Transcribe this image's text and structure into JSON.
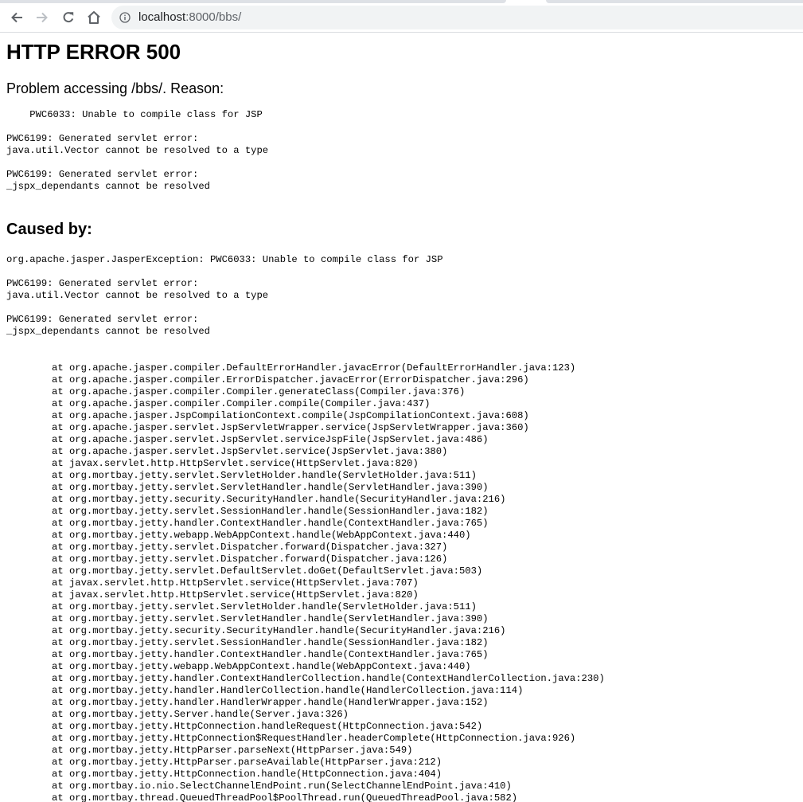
{
  "browser": {
    "url_host": "localhost",
    "url_rest": ":8000/bbs/",
    "icons": [
      "back-arrow-icon",
      "forward-arrow-icon",
      "reload-icon",
      "home-icon",
      "info-icon"
    ]
  },
  "page": {
    "title": "HTTP ERROR 500",
    "reason": "Problem accessing /bbs/. Reason:",
    "reason_message": "    PWC6033: Unable to compile class for JSP",
    "error1_line1": "PWC6199: Generated servlet error:",
    "error1_line2": "java.util.Vector cannot be resolved to a type",
    "error2_line1": "PWC6199: Generated servlet error:",
    "error2_line2": "_jspx_dependants cannot be resolved",
    "caused_by": "Caused by:",
    "exception": "org.apache.jasper.JasperException: PWC6033: Unable to compile class for JSP",
    "cause_error1_line1": "PWC6199: Generated servlet error:",
    "cause_error1_line2": "java.util.Vector cannot be resolved to a type",
    "cause_error2_line1": "PWC6199: Generated servlet error:",
    "cause_error2_line2": "_jspx_dependants cannot be resolved",
    "stack_trace": [
      "at org.apache.jasper.compiler.DefaultErrorHandler.javacError(DefaultErrorHandler.java:123)",
      "at org.apache.jasper.compiler.ErrorDispatcher.javacError(ErrorDispatcher.java:296)",
      "at org.apache.jasper.compiler.Compiler.generateClass(Compiler.java:376)",
      "at org.apache.jasper.compiler.Compiler.compile(Compiler.java:437)",
      "at org.apache.jasper.JspCompilationContext.compile(JspCompilationContext.java:608)",
      "at org.apache.jasper.servlet.JspServletWrapper.service(JspServletWrapper.java:360)",
      "at org.apache.jasper.servlet.JspServlet.serviceJspFile(JspServlet.java:486)",
      "at org.apache.jasper.servlet.JspServlet.service(JspServlet.java:380)",
      "at javax.servlet.http.HttpServlet.service(HttpServlet.java:820)",
      "at org.mortbay.jetty.servlet.ServletHolder.handle(ServletHolder.java:511)",
      "at org.mortbay.jetty.servlet.ServletHandler.handle(ServletHandler.java:390)",
      "at org.mortbay.jetty.security.SecurityHandler.handle(SecurityHandler.java:216)",
      "at org.mortbay.jetty.servlet.SessionHandler.handle(SessionHandler.java:182)",
      "at org.mortbay.jetty.handler.ContextHandler.handle(ContextHandler.java:765)",
      "at org.mortbay.jetty.webapp.WebAppContext.handle(WebAppContext.java:440)",
      "at org.mortbay.jetty.servlet.Dispatcher.forward(Dispatcher.java:327)",
      "at org.mortbay.jetty.servlet.Dispatcher.forward(Dispatcher.java:126)",
      "at org.mortbay.jetty.servlet.DefaultServlet.doGet(DefaultServlet.java:503)",
      "at javax.servlet.http.HttpServlet.service(HttpServlet.java:707)",
      "at javax.servlet.http.HttpServlet.service(HttpServlet.java:820)",
      "at org.mortbay.jetty.servlet.ServletHolder.handle(ServletHolder.java:511)",
      "at org.mortbay.jetty.servlet.ServletHandler.handle(ServletHandler.java:390)",
      "at org.mortbay.jetty.security.SecurityHandler.handle(SecurityHandler.java:216)",
      "at org.mortbay.jetty.servlet.SessionHandler.handle(SessionHandler.java:182)",
      "at org.mortbay.jetty.handler.ContextHandler.handle(ContextHandler.java:765)",
      "at org.mortbay.jetty.webapp.WebAppContext.handle(WebAppContext.java:440)",
      "at org.mortbay.jetty.handler.ContextHandlerCollection.handle(ContextHandlerCollection.java:230)",
      "at org.mortbay.jetty.handler.HandlerCollection.handle(HandlerCollection.java:114)",
      "at org.mortbay.jetty.handler.HandlerWrapper.handle(HandlerWrapper.java:152)",
      "at org.mortbay.jetty.Server.handle(Server.java:326)",
      "at org.mortbay.jetty.HttpConnection.handleRequest(HttpConnection.java:542)",
      "at org.mortbay.jetty.HttpConnection$RequestHandler.headerComplete(HttpConnection.java:926)",
      "at org.mortbay.jetty.HttpParser.parseNext(HttpParser.java:549)",
      "at org.mortbay.jetty.HttpParser.parseAvailable(HttpParser.java:212)",
      "at org.mortbay.jetty.HttpConnection.handle(HttpConnection.java:404)",
      "at org.mortbay.io.nio.SelectChannelEndPoint.run(SelectChannelEndPoint.java:410)",
      "at org.mortbay.thread.QueuedThreadPool$PoolThread.run(QueuedThreadPool.java:582)"
    ]
  }
}
